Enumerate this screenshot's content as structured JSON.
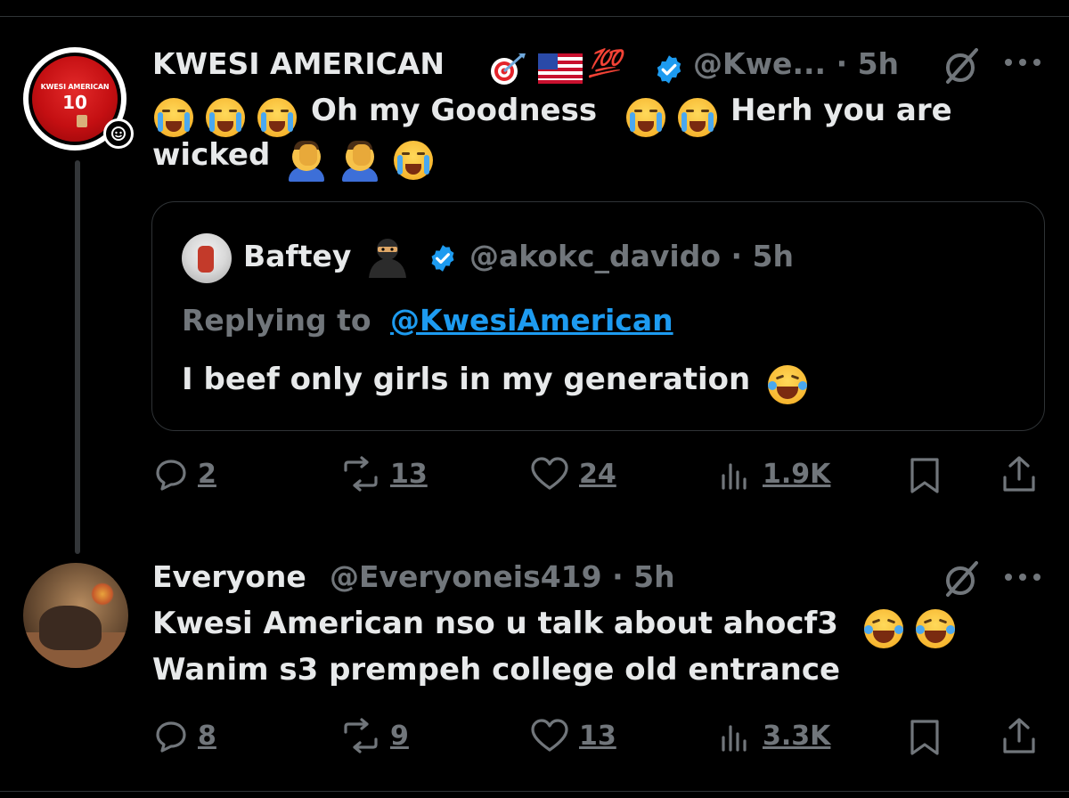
{
  "tweet1": {
    "display_name": "KWESI AMERICAN",
    "name_emojis": [
      "target-icon",
      "us-flag-icon",
      "hundred-points-icon"
    ],
    "hundred_text": "💯",
    "handle": "@Kwe...",
    "time": "· 5h",
    "text_line1": "Oh my Goodness",
    "text_line1b": "Herh you are",
    "text_line2": "wicked",
    "avatar": {
      "jersey_name": "KWESI AMERICAN",
      "jersey_number": "10"
    },
    "actions": {
      "replies": "2",
      "reposts": "13",
      "likes": "24",
      "views": "1.9K"
    }
  },
  "quote": {
    "display_name": "Baftey",
    "handle": "@akokc_davido",
    "time": "· 5h",
    "replying_label": "Replying to",
    "replying_handle": "@KwesiAmerican",
    "text": "I beef only girls in my generation"
  },
  "tweet2": {
    "display_name": "Everyone",
    "handle": "@Everyoneis419",
    "time": "· 5h",
    "text_line1": "Kwesi American nso u talk about ahocf3",
    "text_line2": "Wanim s3 prempeh college old entrance",
    "actions": {
      "replies": "8",
      "reposts": "9",
      "likes": "13",
      "views": "3.3K"
    }
  },
  "colors": {
    "background": "#000000",
    "text": "#e7e9ea",
    "muted": "#71767b",
    "link": "#1d9bf0",
    "verified": "#1d9bf0",
    "border": "#2f3336"
  }
}
